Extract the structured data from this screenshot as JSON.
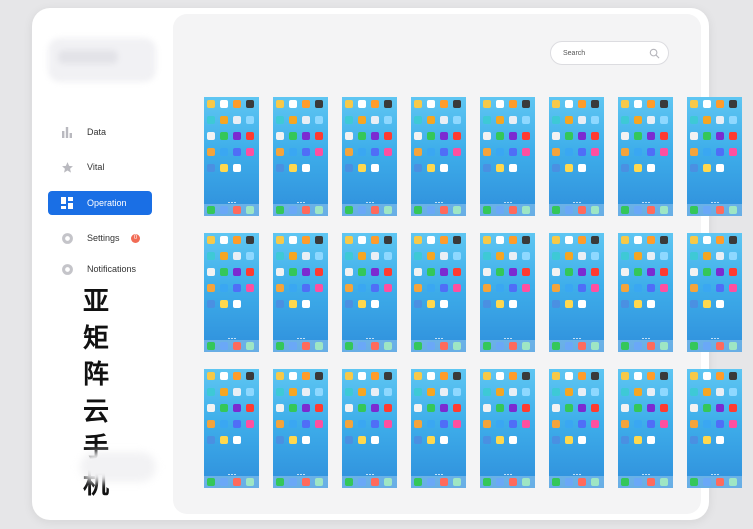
{
  "sidebar": {
    "items": [
      {
        "label": "Data",
        "icon": "bar-chart-icon",
        "active": false
      },
      {
        "label": "Vital",
        "icon": "star-icon",
        "active": false
      },
      {
        "label": "Operation",
        "icon": "grid-icon",
        "active": true
      },
      {
        "label": "Settings",
        "icon": "gear-icon",
        "active": false,
        "badge": "0"
      },
      {
        "label": "Notifications",
        "icon": "bell-icon",
        "active": false
      }
    ]
  },
  "brand": {
    "text": "亚矩阵云手机"
  },
  "search": {
    "placeholder": "Search"
  },
  "devices": {
    "rows": 3,
    "cols": 8,
    "count": 24
  },
  "colors": {
    "accent": "#1a6fe5",
    "badge": "#f16b55",
    "phone_bg": "#3eaeea"
  }
}
